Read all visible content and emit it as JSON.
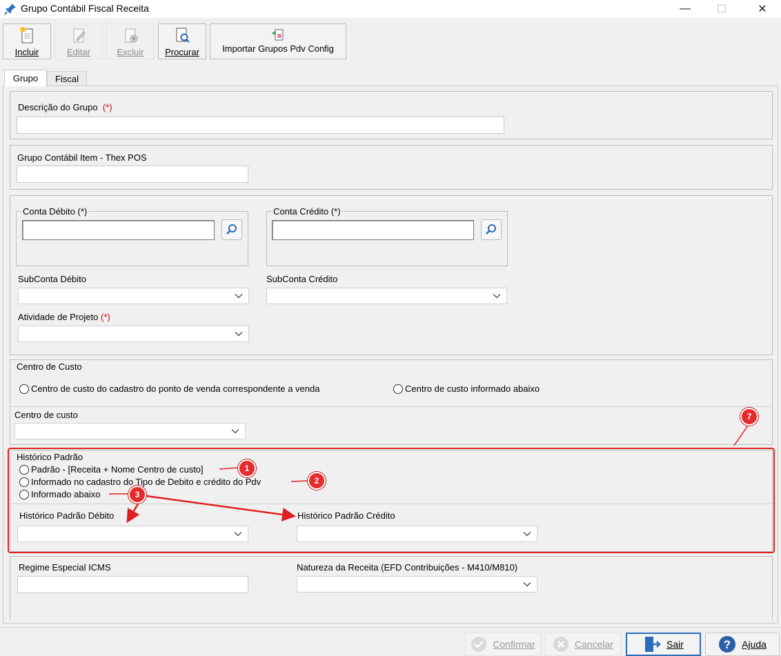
{
  "window": {
    "title": "Grupo Contábil Fiscal Receita",
    "controls": {
      "minimize": "—",
      "maximize": "☐",
      "close": "✕"
    }
  },
  "toolbar": {
    "incluir": "Incluir",
    "editar": "Editar",
    "excluir": "Excluir",
    "procurar": "Procurar",
    "importar": "Importar Grupos Pdv Config"
  },
  "tabs": [
    "Grupo",
    "Fiscal"
  ],
  "form": {
    "descricao_label": "Descrição do Grupo",
    "required_mark": "(*)",
    "descricao_value": "",
    "grupo_item_label": "Grupo Contábil Item - Thex POS",
    "grupo_item_value": "",
    "conta_debito_label": "Conta Débito (*)",
    "conta_debito_value": "",
    "conta_credito_label": "Conta Crédito (*)",
    "conta_credito_value": "",
    "subconta_debito_label": "SubConta Débito",
    "subconta_debito_value": "",
    "subconta_credito_label": "SubConta Crédito",
    "subconta_credito_value": "",
    "atividade_label": "Atividade de Projeto",
    "atividade_value": "",
    "centro_custo_group": "Centro de Custo",
    "centro_opt1": "Centro de custo do cadastro do ponto de venda correspondente a venda",
    "centro_opt2": "Centro de custo informado abaixo",
    "centro_custo_label": "Centro de custo",
    "centro_custo_value": "",
    "historico_group": "Histórico Padrão",
    "hist_opt1": "Padrão - [Receita + Nome Centro de custo]",
    "hist_opt2": "Informado no cadastro do Tipo de Debito e crédito do Pdv",
    "hist_opt3": "Informado abaixo",
    "hist_debito_label": "Histórico Padrão Débito",
    "hist_debito_value": "",
    "hist_credito_label": "Histórico Padrão Crédito",
    "hist_credito_value": "",
    "regime_label": "Regime Especial ICMS",
    "regime_value": "",
    "natureza_label": "Natureza da Receita (EFD Contribuições - M410/M810)",
    "natureza_value": ""
  },
  "annotations": {
    "b1": "1",
    "b2": "2",
    "b3": "3",
    "b7": "7",
    "color": "#e02020"
  },
  "footer": {
    "confirmar": "Confirmar",
    "cancelar": "Cancelar",
    "sair": "Sair",
    "ajuda": "Ajuda"
  },
  "colors": {
    "accent": "#2b6cb8",
    "required": "#d40000",
    "highlight": "#e02020"
  }
}
